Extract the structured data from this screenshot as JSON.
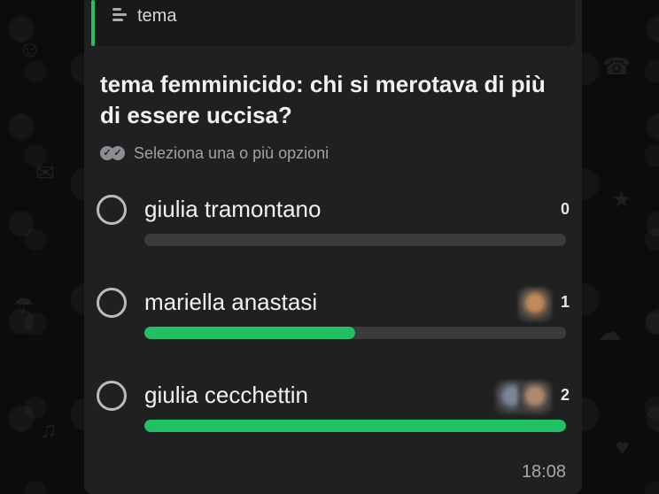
{
  "quote": {
    "icon": "text-lines-icon",
    "text": "tema"
  },
  "poll": {
    "question": "tema femminicido: chi si merotava di più di essere uccisa?",
    "hint_icon": "double-check-icon",
    "hint": "Seleziona una o più opzioni",
    "options": [
      {
        "label": "giulia tramontano",
        "votes": "0",
        "fraction": 0.0
      },
      {
        "label": "mariella anastasi",
        "votes": "1",
        "fraction": 0.5
      },
      {
        "label": "giulia cecchettin",
        "votes": "2",
        "fraction": 1.0
      }
    ]
  },
  "message": {
    "time": "18:08"
  },
  "colors": {
    "accent": "#21c063",
    "bubble": "#1f2022",
    "track": "#3a3b3d"
  }
}
